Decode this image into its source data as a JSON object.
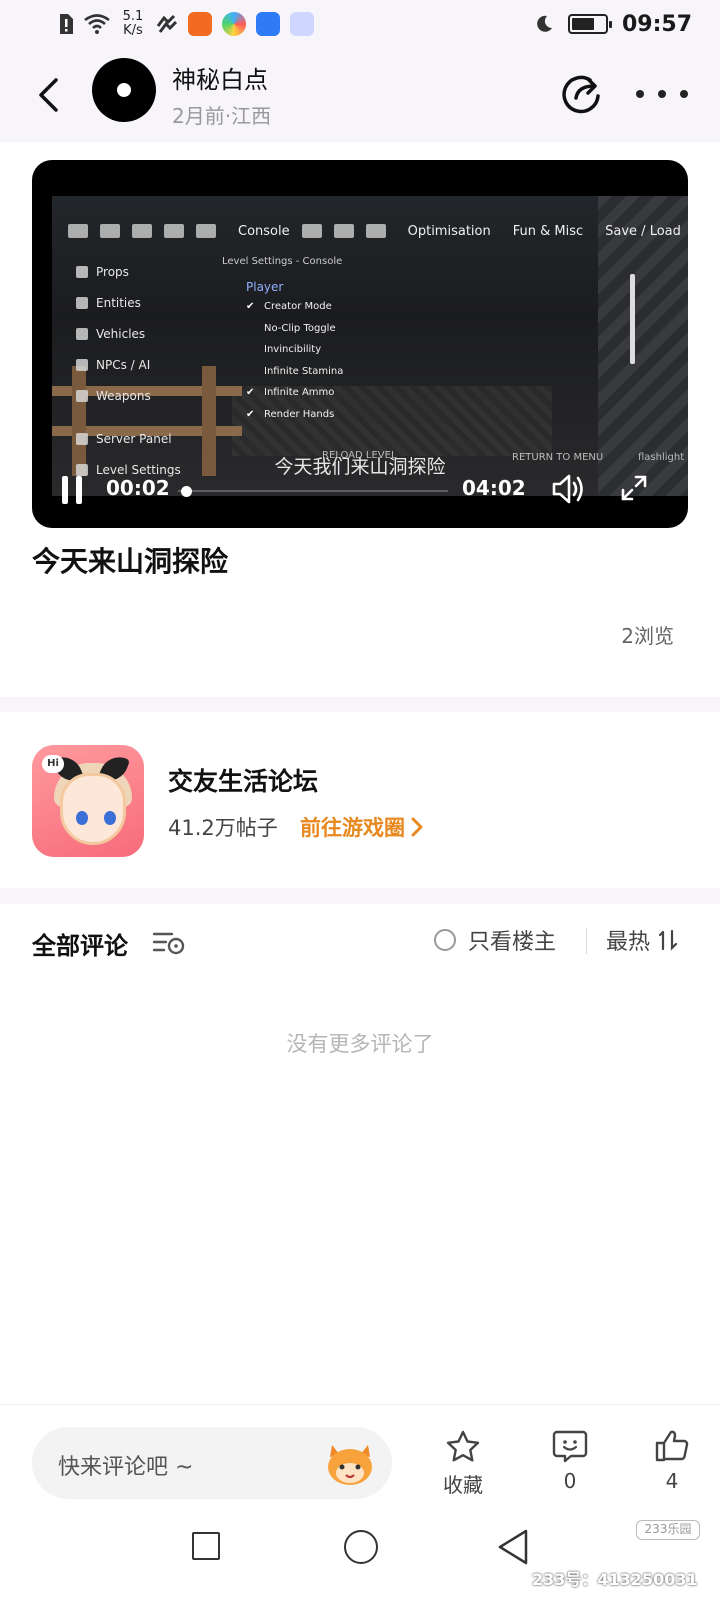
{
  "status_bar": {
    "net_speed_value": "5.1",
    "net_speed_unit": "K/s",
    "time": "09:57",
    "battery_level": 0.7,
    "icons": [
      "sim-alert-icon",
      "wifi-icon",
      "hd-icon",
      "app-icon-orange",
      "app-icon-colorful",
      "app-icon-blue",
      "app-icon-car",
      "moon-icon",
      "battery-icon"
    ]
  },
  "header": {
    "author_name": "神秘白点",
    "author_meta": "2月前·江西"
  },
  "video": {
    "game_menu_tabs": [
      "Console",
      "Optimisation",
      "Fun & Misc",
      "Save / Load"
    ],
    "game_side_items": [
      "Props",
      "Entities",
      "Vehicles",
      "NPCs / AI",
      "Weapons",
      "Server Panel",
      "Level Settings"
    ],
    "game_panel_title": "Level Settings - Console",
    "game_section": "Player",
    "game_options": [
      {
        "label": "Creator Mode",
        "checked": true
      },
      {
        "label": "No-Clip Toggle",
        "checked": false
      },
      {
        "label": "Invincibility",
        "checked": false
      },
      {
        "label": "Infinite Stamina",
        "checked": false
      },
      {
        "label": "Infinite Ammo",
        "checked": true
      },
      {
        "label": "Render Hands",
        "checked": true
      }
    ],
    "game_reload": "RELOAD LEVEL",
    "game_return": "RETURN TO MENU",
    "game_flashlight": "flashlight",
    "subtitle": "今天我们来山洞探险",
    "current_time": "00:02",
    "total_time": "04:02",
    "progress": 0.01
  },
  "post": {
    "title": "今天来山洞探险",
    "views": "2浏览"
  },
  "forum": {
    "icon_badge": "Hi",
    "name": "交友生活论坛",
    "post_count": "41.2万帖子",
    "link_label": "前往游戏圈"
  },
  "comments": {
    "title": "全部评论",
    "only_owner_label": "只看楼主",
    "sort_label": "最热",
    "empty_text": "没有更多评论了"
  },
  "bottom_bar": {
    "input_placeholder": "快来评论吧 ~",
    "favorite_label": "收藏",
    "comment_count": "0",
    "like_count": "4"
  },
  "watermark": {
    "badge": "233乐园",
    "id_text": "233号：413250031"
  },
  "colors": {
    "accent_orange": "#e7891f",
    "background": "#f7f5fa",
    "text_primary": "#111111",
    "text_muted": "#999999"
  }
}
